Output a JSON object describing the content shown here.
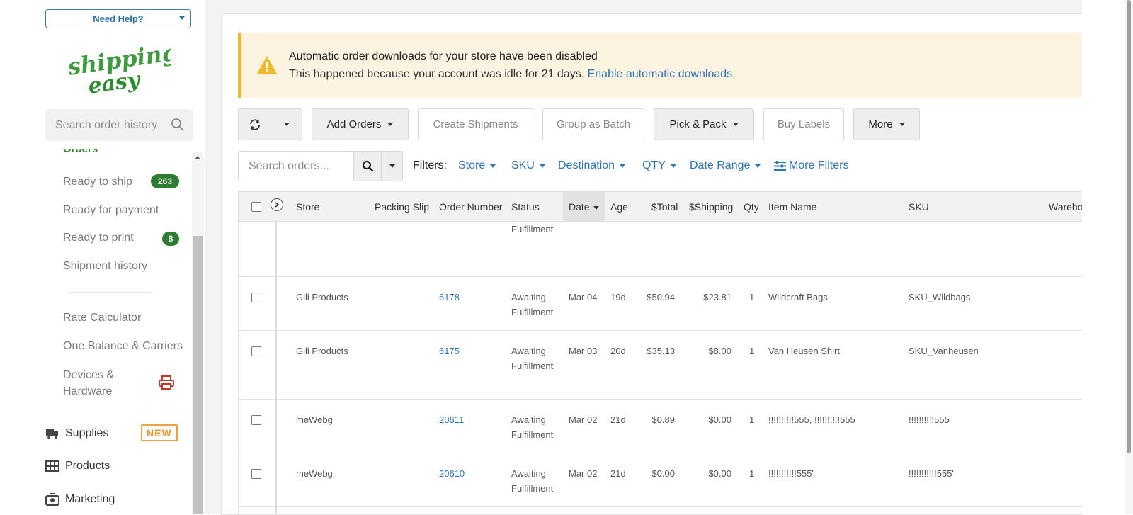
{
  "sidebar": {
    "help_label": "Need Help?",
    "logo_top": "shipping",
    "logo_bottom": "easy",
    "search_placeholder": "Search order history",
    "orders_cut": "Orders",
    "items": [
      {
        "label": "Ready to ship",
        "badge": "263"
      },
      {
        "label": "Ready for payment"
      },
      {
        "label": "Ready to print",
        "badge": "8"
      },
      {
        "label": "Shipment history"
      },
      {
        "label": "Rate Calculator"
      },
      {
        "label": "One Balance & Carriers"
      },
      {
        "label": "Devices & Hardware"
      }
    ],
    "main_nav": [
      {
        "label": "Supplies",
        "tag": "NEW"
      },
      {
        "label": "Products"
      },
      {
        "label": "Marketing"
      }
    ]
  },
  "alert": {
    "title": "Automatic order downloads for your store have been disabled",
    "body": "This happened because your account was idle for 21 days. ",
    "link": "Enable automatic downloads",
    "end": "."
  },
  "toolbar": {
    "add_orders": "Add Orders",
    "create_shipments": "Create Shipments",
    "group_batch": "Group as Batch",
    "pick_pack": "Pick & Pack",
    "buy_labels": "Buy Labels",
    "more": "More"
  },
  "filters": {
    "search_placeholder": "Search orders...",
    "label": "Filters:",
    "items": [
      "Store",
      "SKU",
      "Destination",
      "QTY",
      "Date Range"
    ],
    "more_filters": "More Filters"
  },
  "table": {
    "headers": {
      "store": "Store",
      "packing_slip": "Packing Slip",
      "order_number": "Order Number",
      "status": "Status",
      "date": "Date",
      "age": "Age",
      "total": "$Total",
      "shipping": "$Shipping",
      "qty": "Qty",
      "item_name": "Item Name",
      "sku": "SKU",
      "warehouse": "Wareho"
    },
    "partial_row_status": "Fulfillment",
    "rows": [
      {
        "store": "Gili Products",
        "order": "6178",
        "status1": "Awaiting",
        "status2": "Fulfillment",
        "date": "Mar 04",
        "age": "19d",
        "total": "$50.94",
        "shipping": "$23.81",
        "qty": "1",
        "item": "Wildcraft Bags",
        "sku": "SKU_Wildbags"
      },
      {
        "store": "Gili Products",
        "order": "6175",
        "status1": "Awaiting",
        "status2": "Fulfillment",
        "date": "Mar 03",
        "age": "20d",
        "total": "$35.13",
        "shipping": "$8.00",
        "qty": "1",
        "item": "Van Heusen Shirt",
        "sku": "SKU_Vanheusen"
      },
      {
        "store": "meWebg",
        "order": "20611",
        "status1": "Awaiting",
        "status2": "Fulfillment",
        "date": "Mar 02",
        "age": "21d",
        "total": "$0.89",
        "shipping": "$0.00",
        "qty": "1",
        "item": "!!!!!!!!!!555, !!!!!!!!!!555",
        "sku": "!!!!!!!!!!555"
      },
      {
        "store": "meWebg",
        "order": "20610",
        "status1": "Awaiting",
        "status2": "Fulfillment",
        "date": "Mar 02",
        "age": "21d",
        "total": "$0.00",
        "shipping": "$0.00",
        "qty": "1",
        "item": "!!!!!!!!!!!555'",
        "sku": "!!!!!!!!!!!555'"
      }
    ]
  }
}
